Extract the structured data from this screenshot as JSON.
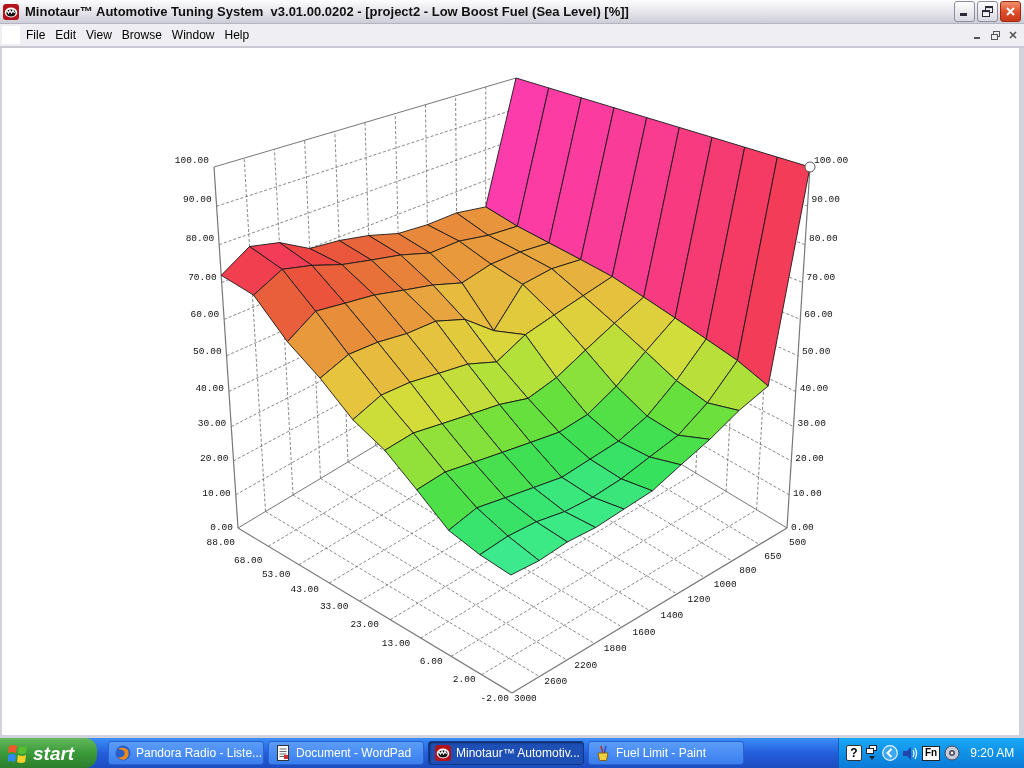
{
  "window": {
    "title": "Minotaur™ Automotive Tuning System  v3.01.00.0202 - [project2 - Low Boost Fuel (Sea Level) [%]]"
  },
  "menu_bar": {
    "items": [
      "File",
      "Edit",
      "View",
      "Browse",
      "Window",
      "Help"
    ]
  },
  "chart": {
    "z_axis_left": {
      "ticks": [
        "100.00",
        "90.00",
        "80.00",
        "70.00",
        "60.00",
        "50.00",
        "40.00",
        "30.00",
        "20.00",
        "10.00",
        "0.00"
      ]
    },
    "z_axis_right": {
      "ticks": [
        "100.00",
        "90.00",
        "80.00",
        "70.00",
        "60.00",
        "50.00",
        "40.00",
        "30.00",
        "20.00",
        "10.00",
        "0.00"
      ]
    },
    "load_axis": {
      "ticks": [
        "88.00",
        "68.00",
        "53.00",
        "43.00",
        "33.00",
        "23.00",
        "13.00",
        "6.00",
        "2.00",
        "-2.00"
      ]
    },
    "rpm_axis": {
      "ticks": [
        "500",
        "650",
        "800",
        "1000",
        "1200",
        "1400",
        "1600",
        "1800",
        "2200",
        "2600",
        "3000"
      ]
    }
  },
  "taskbar": {
    "start": "start",
    "tasks": [
      {
        "kind": "browser",
        "label": "Pandora Radio - Liste...",
        "selected": false
      },
      {
        "kind": "document",
        "label": "Document - WordPad",
        "selected": false
      },
      {
        "kind": "app",
        "label": "Minotaur™ Automotiv...",
        "selected": true
      },
      {
        "kind": "paint",
        "label": "Fuel Limit - Paint",
        "selected": false
      }
    ],
    "tray": {
      "help_key": "?",
      "fn_key": "Fn",
      "clock": "9:20 AM"
    }
  }
}
